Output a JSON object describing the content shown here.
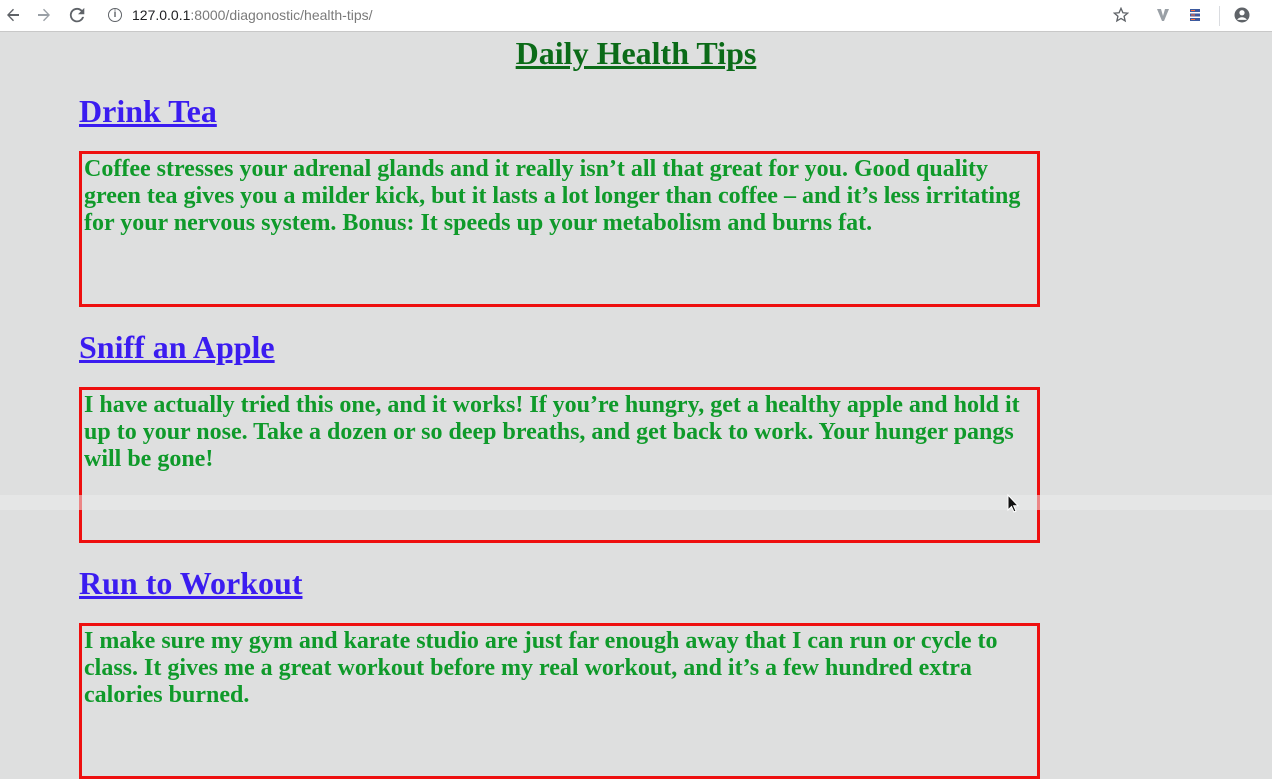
{
  "browser": {
    "url_host": "127.0.0.1",
    "url_path": ":8000/diagonostic/health-tips/",
    "back_icon": "back-arrow-icon",
    "forward_icon": "forward-arrow-icon",
    "reload_icon": "reload-icon",
    "info_icon": "info-icon",
    "info_glyph": "i",
    "bookmark_icon": "star-icon",
    "profile_icon": "account-circle-icon"
  },
  "page": {
    "title": "Daily Health Tips",
    "tips": [
      {
        "title": "Drink Tea",
        "body": "Coffee stresses your adrenal glands and it really isn’t all that great for you. Good quality green tea gives you a milder kick, but it lasts a lot longer than coffee – and it’s less irritating for your nervous system. Bonus: It speeds up your metabolism and burns fat."
      },
      {
        "title": "Sniff an Apple",
        "body": "I have actually tried this one, and it works! If you’re hungry, get a healthy apple and hold it up to your nose. Take a dozen or so deep breaths, and get back to work. Your hunger pangs will be gone!"
      },
      {
        "title": "Run to Workout",
        "body": "I make sure my gym and karate studio are just far enough away that I can run or cycle to class. It gives me a great workout before my real workout, and it’s a few hundred extra calories burned."
      }
    ]
  },
  "colors": {
    "page_background": "#dedfdf",
    "title": "#0b6b18",
    "tip_title": "#3b1cf0",
    "tip_body": "#0f9a2a",
    "tip_border": "#ee0f0f"
  }
}
